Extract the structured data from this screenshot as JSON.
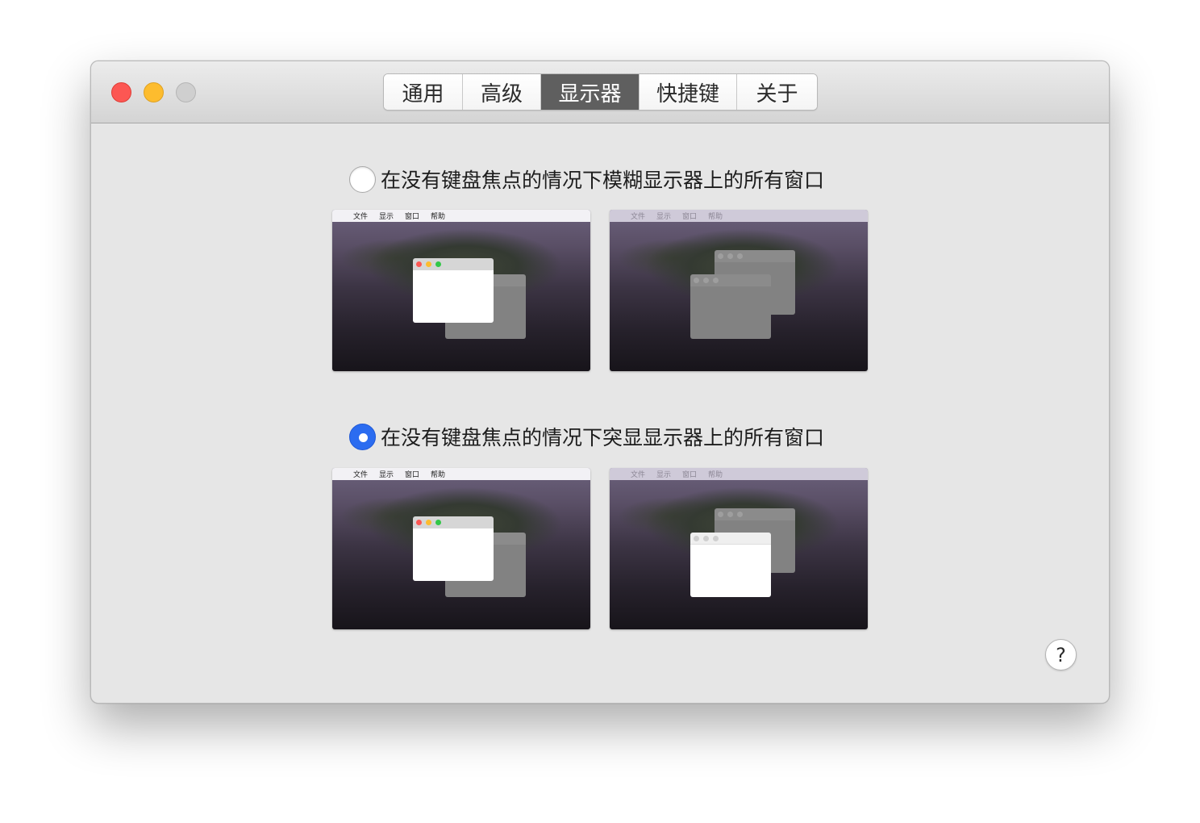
{
  "tabs": [
    {
      "label": "通用",
      "active": false
    },
    {
      "label": "高级",
      "active": false
    },
    {
      "label": "显示器",
      "active": true
    },
    {
      "label": "快捷键",
      "active": false
    },
    {
      "label": "关于",
      "active": false
    }
  ],
  "options": [
    {
      "label": "在没有键盘焦点的情况下模糊显示器上的所有窗口",
      "checked": false
    },
    {
      "label": "在没有键盘焦点的情况下突显显示器上的所有窗口",
      "checked": true
    }
  ],
  "preview_menu": {
    "apple": "",
    "items": [
      "文件",
      "显示",
      "窗口",
      "帮助"
    ]
  },
  "help_label": "?",
  "colors": {
    "accent": "#2b6cf0",
    "active_tab": "#5f5f5f",
    "close": "#fc5753",
    "minimize": "#fdbc2e"
  }
}
